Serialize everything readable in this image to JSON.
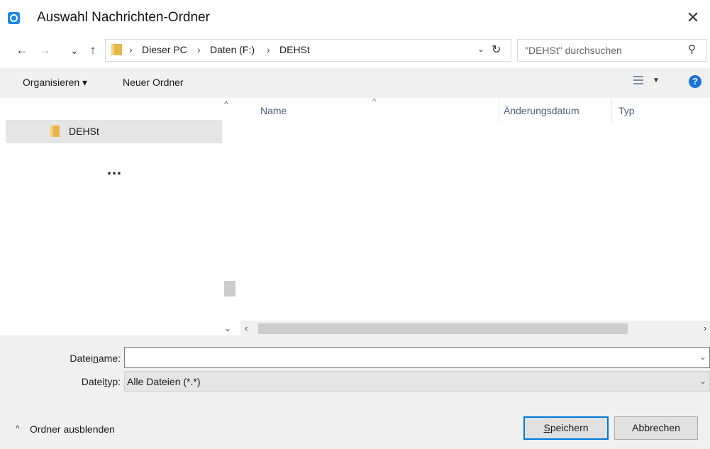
{
  "window": {
    "title": "Auswahl Nachrichten-Ordner",
    "close_glyph": "✕",
    "app_icon": "app-logo-icon"
  },
  "navigation": {
    "back_glyph": "←",
    "forward_glyph": "→",
    "recent_glyph": "⌄",
    "up_glyph": "↑",
    "breadcrumb": [
      "Dieser PC",
      "Daten (F:)",
      "DEHSt"
    ],
    "separator": "›",
    "dropdown_glyph": "⌄",
    "refresh_glyph": "↻"
  },
  "search": {
    "placeholder": "\"DEHSt\" durchsuchen",
    "icon_glyph": "⚲"
  },
  "toolbar": {
    "organize_label": "Organisieren ▾",
    "new_folder_label": "Neuer Ordner",
    "view_dropdown_glyph": "▼",
    "help_glyph": "?"
  },
  "nav_pane": {
    "items": [
      {
        "label": "DEHSt"
      }
    ],
    "ellipsis": "…"
  },
  "file_list": {
    "sort_glyph": "^",
    "columns": [
      "Name",
      "Änderungsdatum",
      "Typ"
    ],
    "rows": []
  },
  "scroll": {
    "up": "^",
    "down": "⌄",
    "left": "‹",
    "right": "›"
  },
  "form": {
    "filename_label": {
      "pre": "Datei",
      "ul": "n",
      "post": "ame:"
    },
    "filename_value": "",
    "filetype_label": {
      "pre": "Datei",
      "ul": "t",
      "post": "yp:"
    },
    "filetype_value": "Alle Dateien (*.*)",
    "dd_glyph": "⌄"
  },
  "footer": {
    "hide_caret": "^",
    "hide_folders_label": "Ordner ausblenden",
    "save_button": {
      "ul": "S",
      "rest": "peichern"
    },
    "cancel_button": "Abbrechen"
  },
  "colors": {
    "accent": "#0078d7",
    "selection": "#e5e5e5",
    "chrome": "#f0f0f0",
    "help": "#1a73d9"
  }
}
